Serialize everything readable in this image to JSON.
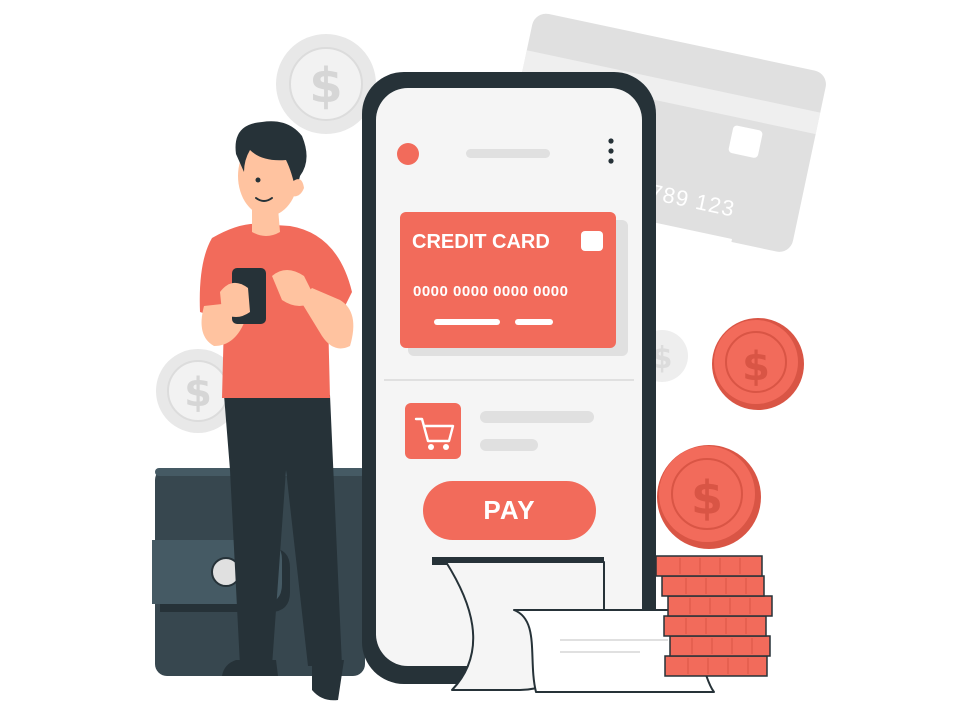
{
  "credit_card": {
    "title": "CREDIT CARD",
    "number": "0000 0000 0000 0000"
  },
  "background_card": {
    "number_fragment": "789 123"
  },
  "pay_button": {
    "label": "PAY"
  },
  "coin_symbol": "$",
  "colors": {
    "accent": "#f26b5b",
    "accent_dark": "#d95545",
    "wallet": "#37474f",
    "skin": "#ffc3a0",
    "hair": "#263238",
    "phone_frame": "#263238",
    "grey": "#e0e0e0"
  },
  "icons": [
    "cart-icon",
    "dollar-coin-icon",
    "menu-dots-icon",
    "wallet-icon",
    "receipt-icon"
  ]
}
